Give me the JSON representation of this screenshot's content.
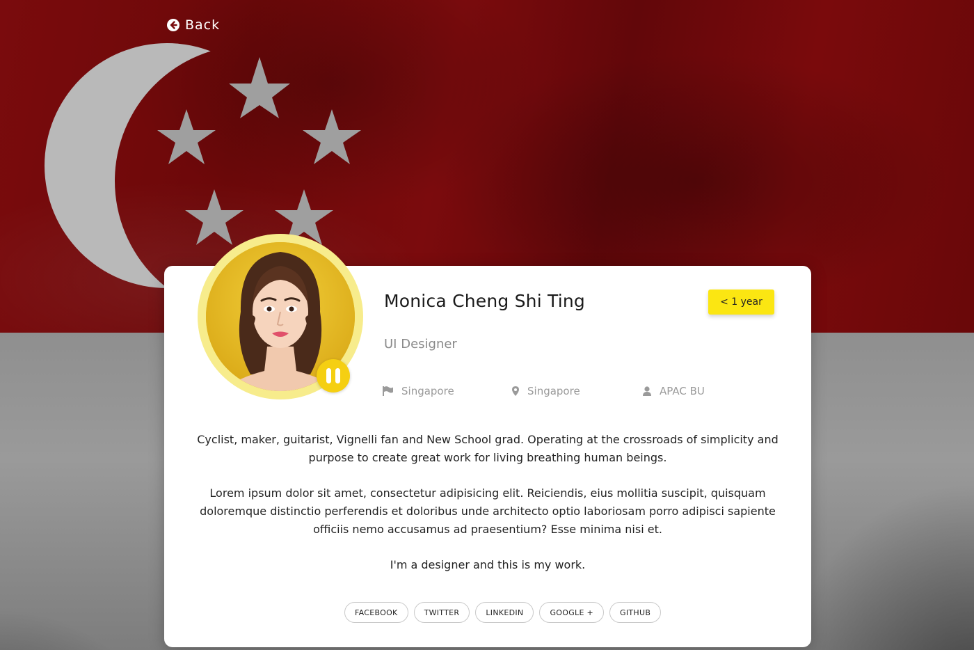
{
  "nav": {
    "back_label": "Back"
  },
  "profile": {
    "name": "Monica Cheng Shi Ting",
    "role": "UI Designer",
    "tenure_badge": "< 1 year",
    "country": "Singapore",
    "location": "Singapore",
    "business_unit": "APAC BU"
  },
  "bio": {
    "paragraph_1": "Cyclist, maker, guitarist, Vignelli fan and New School grad. Operating at the crossroads of simplicity and purpose to create great work for living breathing human beings.",
    "paragraph_2": "Lorem ipsum dolor sit amet, consectetur adipisicing elit. Reiciendis, eius mollitia suscipit, quisquam doloremque distinctio perferendis et doloribus unde architecto optio laboriosam porro adipisci sapiente officiis nemo accusamus ad praesentium? Esse minima nisi et.",
    "paragraph_3": "I'm a designer and this is my work."
  },
  "socials": [
    "FACEBOOK",
    "TWITTER",
    "LINKEDIN",
    "GOOGLE +",
    "GITHUB"
  ],
  "icons": {
    "back": "arrow-circle-left-icon",
    "audio": "pause-icon",
    "country": "flag-icon",
    "location": "map-pin-icon",
    "business_unit": "user-icon"
  },
  "colors": {
    "accent_yellow": "#fbe612",
    "flag_red": "#7a0b0d",
    "flag_grey": "#8f8f8f",
    "muted_text": "#8a8a8a"
  }
}
